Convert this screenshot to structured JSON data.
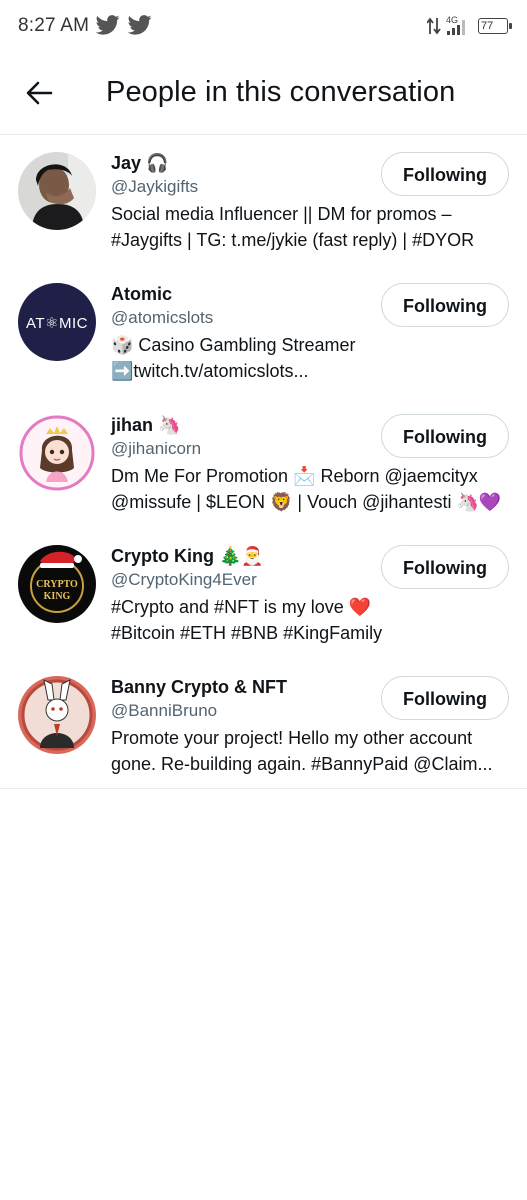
{
  "status_bar": {
    "time": "8:27 AM",
    "network": "4G",
    "battery": "77",
    "icons": [
      "twitter-bird-icon",
      "twitter-bird-icon",
      "data-arrows-icon",
      "signal-icon",
      "battery-icon"
    ]
  },
  "header": {
    "back_icon": "back-arrow-icon",
    "title": "People in this conversation"
  },
  "people": [
    {
      "name": "Jay 🎧",
      "handle": "@Jaykigifts",
      "bio": [
        "Social media Influencer || DM for promos –",
        "#Jaygifts | TG: t.me/jykie (fast reply) | #DYOR"
      ],
      "button": "Following",
      "avatar": "person-photo"
    },
    {
      "name": "Atomic",
      "handle": "@atomicslots",
      "bio": [
        "🎲 Casino Gambling Streamer",
        "➡️twitch.tv/atomicslots..."
      ],
      "button": "Following",
      "avatar_text": "AT⚛MIC",
      "avatar_color": "#1f1f47"
    },
    {
      "name": "jihan 🦄",
      "handle": "@jihanicorn",
      "bio": [
        "Dm Me For Promotion 📩 Reborn @jaemcityx",
        "@missufe | $LEON 🦁 | Vouch @jihantesti 🦄💜"
      ],
      "button": "Following",
      "avatar": "cartoon-girl"
    },
    {
      "name": "Crypto King 🎄🎅",
      "handle": "@CryptoKing4Ever",
      "bio": [
        "#Crypto and #NFT is my love ❤️",
        "#Bitcoin #ETH #BNB #KingFamily"
      ],
      "button": "Following",
      "avatar_text_1": "CRYPTO",
      "avatar_text_2": "KING"
    },
    {
      "name": "Banny Crypto & NFT",
      "handle": "@BanniBruno",
      "bio": [
        "Promote your project! Hello my other account",
        "gone. Re-building again. #BannyPaid @Claim..."
      ],
      "button": "Following",
      "avatar": "rabbit-in-suit"
    }
  ],
  "colors": {
    "primary_text": "#0f1419",
    "secondary_text": "#536471",
    "border": "#cfd9de",
    "divider": "#e6ecf0"
  }
}
